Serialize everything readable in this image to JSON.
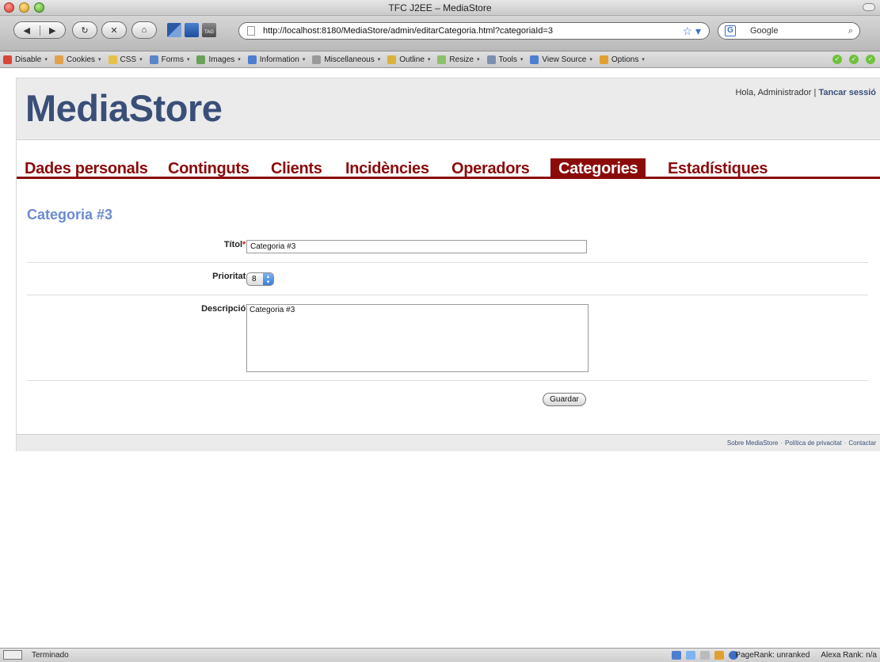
{
  "browser": {
    "window_title": "TFC J2EE – MediaStore",
    "url": "http://localhost:8180/MediaStore/admin/editarCategoria.html?categoriaId=3",
    "search_engine": "Google",
    "ext_tag_label": "TAG",
    "toolbar_items": [
      {
        "label": "Disable",
        "icon": "disable-icon",
        "color": "#d9463a"
      },
      {
        "label": "Cookies",
        "icon": "cookies-icon",
        "color": "#e0a14a"
      },
      {
        "label": "CSS",
        "icon": "css-icon",
        "color": "#e7c04a"
      },
      {
        "label": "Forms",
        "icon": "forms-icon",
        "color": "#5a86c8"
      },
      {
        "label": "Images",
        "icon": "images-icon",
        "color": "#6aa05a"
      },
      {
        "label": "Information",
        "icon": "information-icon",
        "color": "#4d7fd0"
      },
      {
        "label": "Miscellaneous",
        "icon": "miscellaneous-icon",
        "color": "#9a9a9a"
      },
      {
        "label": "Outline",
        "icon": "outline-icon",
        "color": "#d9b238"
      },
      {
        "label": "Resize",
        "icon": "resize-icon",
        "color": "#8cc06a"
      },
      {
        "label": "Tools",
        "icon": "tools-icon",
        "color": "#7d8fb0"
      },
      {
        "label": "View Source",
        "icon": "view-source-icon",
        "color": "#4d7fd0"
      },
      {
        "label": "Options",
        "icon": "options-icon",
        "color": "#e0a030"
      }
    ],
    "status": "Terminado",
    "pagerank": "PageRank: unranked",
    "alexa": "Alexa Rank: n/a"
  },
  "site": {
    "logo": "MediaStore",
    "greeting": "Hola, Administrador | ",
    "logout": "Tancar sessió",
    "nav": [
      {
        "label": "Dades personals",
        "active": false
      },
      {
        "label": "Continguts",
        "active": false
      },
      {
        "label": "Clients",
        "active": false
      },
      {
        "label": "Incidències",
        "active": false
      },
      {
        "label": "Operadors",
        "active": false
      },
      {
        "label": "Categories",
        "active": true
      },
      {
        "label": "Estadístiques",
        "active": false
      }
    ],
    "accent_color": "#8b0b0b"
  },
  "form": {
    "heading": "Categoria #3",
    "title_label": "Títol",
    "required_mark": "*",
    "colon": ":",
    "title_value": "Categoria #3",
    "priority_label": "Prioritat:",
    "priority_value": "8",
    "description_label": "Descripció:",
    "description_value": "Categoria #3",
    "save_label": "Guardar"
  },
  "footer": {
    "about": "Sobre MediaStore",
    "privacy": "Política de privacitat",
    "contact": "Contactar",
    "separator": "·"
  }
}
